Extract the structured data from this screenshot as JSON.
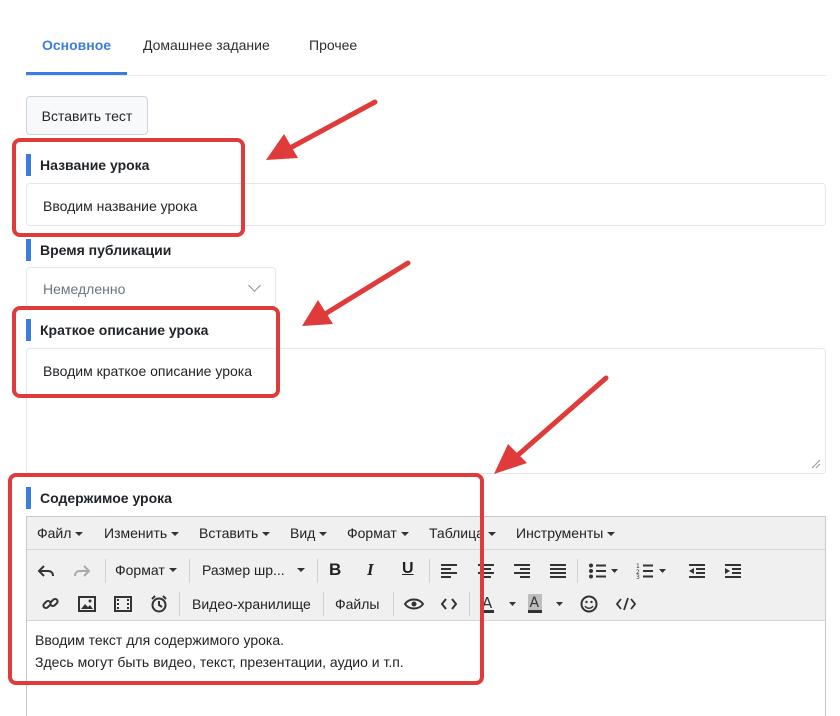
{
  "tabs": [
    "Основное",
    "Домашнее задание",
    "Прочее"
  ],
  "insert_test_button": "Вставить тест",
  "lesson_name": {
    "label": "Название урока",
    "value": "Вводим название урока"
  },
  "publish_time": {
    "label": "Время публикации",
    "value": "Немедленно"
  },
  "short_description": {
    "label": "Краткое описание урока",
    "value": "Вводим краткое описание урока"
  },
  "lesson_content": {
    "label": "Содержимое урока",
    "menu": [
      "Файл",
      "Изменить",
      "Вставить",
      "Вид",
      "Формат",
      "Таблица",
      "Инструменты"
    ],
    "format_dropdown": "Формат",
    "size_dropdown": "Размер шр...",
    "video_storage": "Видео-хранилище",
    "files": "Файлы",
    "text_line_1": "Вводим текст для содержимого урока.",
    "text_line_2": "Здесь могут быть видео, текст, презентации, аудио и т.п."
  },
  "colors": {
    "accent": "#3b7ddd",
    "annotation": "#e03b3b"
  }
}
